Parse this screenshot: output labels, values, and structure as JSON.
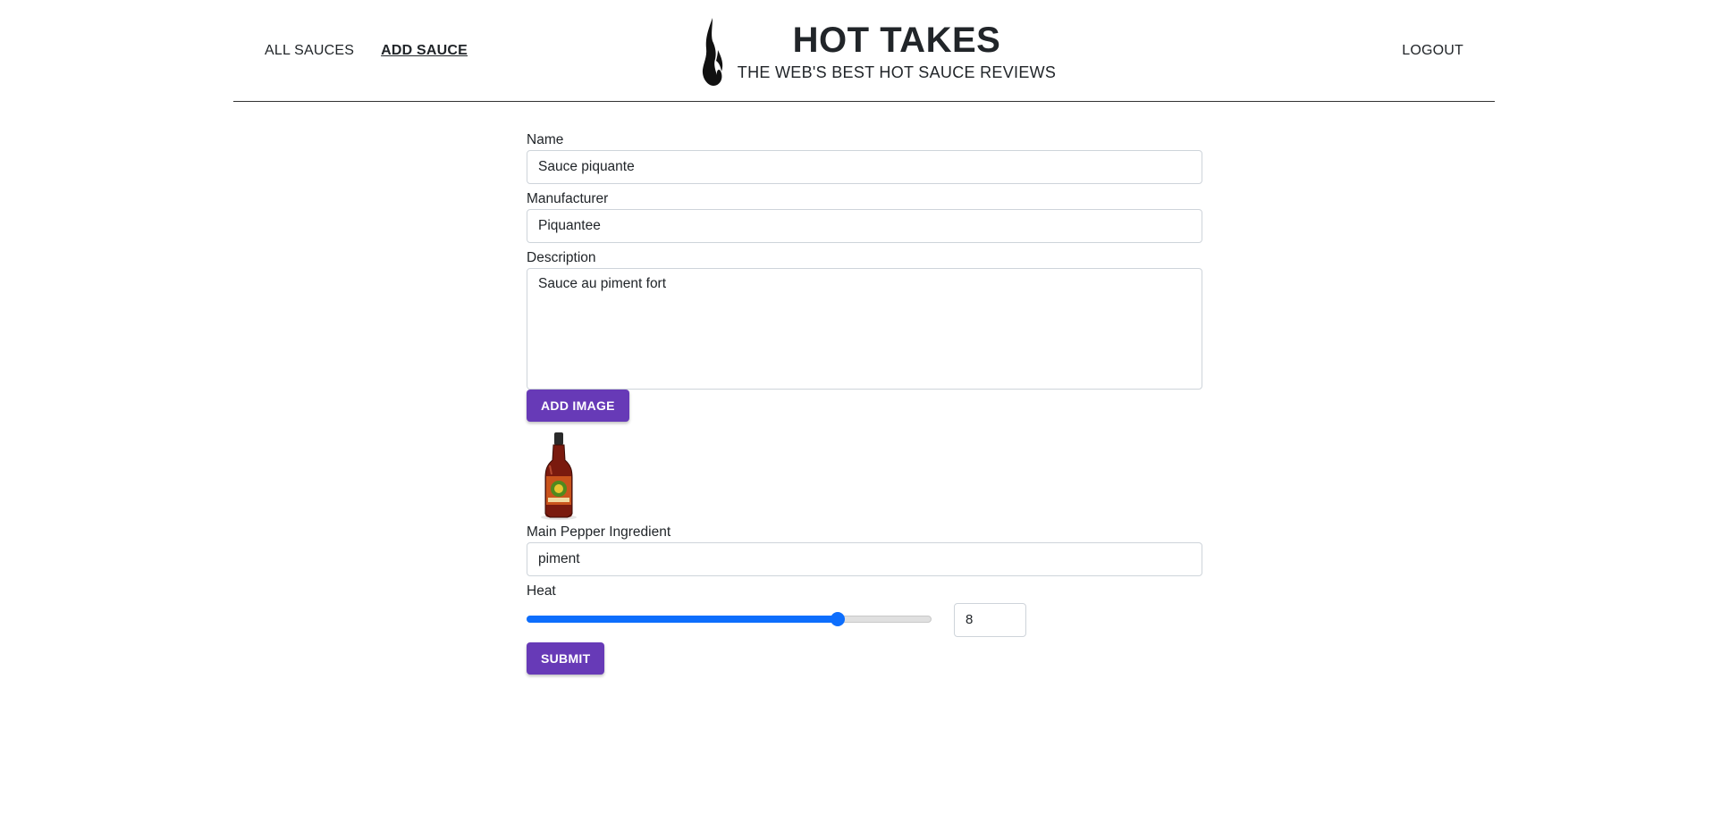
{
  "header": {
    "nav": [
      {
        "label": "ALL SAUCES",
        "active": false
      },
      {
        "label": "ADD SAUCE",
        "active": true
      }
    ],
    "brand_title": "HOT TAKES",
    "brand_subtitle": "THE WEB'S BEST HOT SAUCE REVIEWS",
    "logout_label": "LOGOUT",
    "logo_icon": "flame-icon"
  },
  "form": {
    "name_label": "Name",
    "name_value": "Sauce piquante",
    "manufacturer_label": "Manufacturer",
    "manufacturer_value": "Piquantee",
    "description_label": "Description",
    "description_value": "Sauce au piment fort",
    "add_image_label": "ADD IMAGE",
    "preview_image": "hot-sauce-bottle-image",
    "pepper_label": "Main Pepper Ingredient",
    "pepper_value": "piment",
    "heat_label": "Heat",
    "heat_value": "8",
    "heat_min": 1,
    "heat_max": 10,
    "submit_label": "SUBMIT"
  },
  "colors": {
    "button": "#673ab7",
    "slider": "#0d6efd",
    "text": "#212529"
  }
}
